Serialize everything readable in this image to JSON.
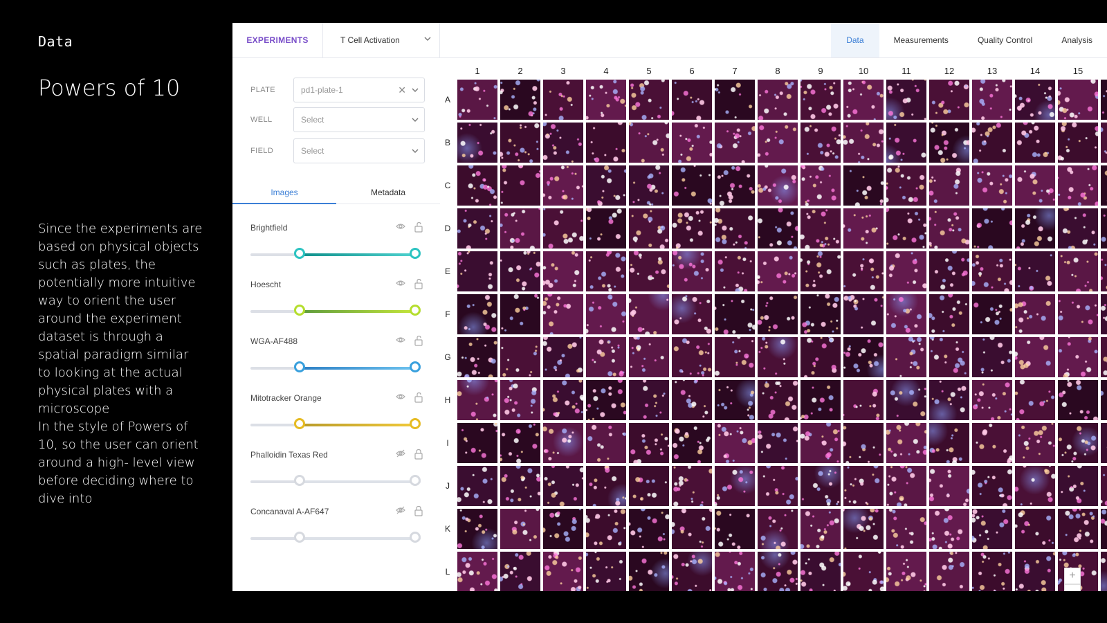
{
  "slide": {
    "eyebrow": "Data",
    "title": "Powers of 10",
    "paragraph1": "Since the experiments are based on physical objects such as plates, the potentially more intuitive way to orient the user around the experiment dataset is through a spatial paradigm similar to looking at the actual physical plates with a microscope",
    "paragraph2": "In the style of Powers of 10, so the user can orient around a high- level view before deciding where to dive into"
  },
  "topbar": {
    "experiments_tab": "EXPERIMENTS",
    "experiment_selected": "T Cell Activation",
    "nav": [
      "Data",
      "Measurements",
      "Quality Control",
      "Analysis"
    ],
    "active_nav": "Data"
  },
  "filters": {
    "plate_label": "PLATE",
    "plate_value": "pd1-plate-1",
    "well_label": "WELL",
    "well_value": "Select",
    "field_label": "FIELD",
    "field_value": "Select"
  },
  "subtabs": {
    "images": "Images",
    "metadata": "Metadata",
    "active": "Images"
  },
  "channels": [
    {
      "name": "Brightfield",
      "visible": true,
      "locked": false,
      "range": [
        0.3,
        1.0
      ],
      "color_start": "#0f8f8a",
      "color_end": "#4fd2cf",
      "knob_color": "#2cc3c1"
    },
    {
      "name": "Hoescht",
      "visible": true,
      "locked": false,
      "range": [
        0.3,
        1.0
      ],
      "color_start": "#5c9a3c",
      "color_end": "#c5e63b",
      "knob_color": "#b5de2e"
    },
    {
      "name": "WGA-AF488",
      "visible": true,
      "locked": false,
      "range": [
        0.3,
        1.0
      ],
      "color_start": "#2d7fc4",
      "color_end": "#6ec3ef",
      "knob_color": "#39a0dd"
    },
    {
      "name": "Mitotracker Orange",
      "visible": true,
      "locked": false,
      "range": [
        0.3,
        1.0
      ],
      "color_start": "#b89a2a",
      "color_end": "#f0c93a",
      "knob_color": "#e6bb22"
    },
    {
      "name": "Phalloidin Texas Red",
      "visible": false,
      "locked": true,
      "range": [
        0.3,
        1.0
      ],
      "color_start": "#dde1e8",
      "color_end": "#dde1e8",
      "knob_color": "#d6d9df"
    },
    {
      "name": "Concanaval A-AF647",
      "visible": false,
      "locked": true,
      "range": [
        0.3,
        1.0
      ],
      "color_start": "#dde1e8",
      "color_end": "#dde1e8",
      "knob_color": "#d6d9df"
    }
  ],
  "plate": {
    "columns": [
      "1",
      "2",
      "3",
      "4",
      "5",
      "6",
      "7",
      "8",
      "9",
      "10",
      "11",
      "12",
      "13",
      "14",
      "15"
    ],
    "rows": [
      "A",
      "B",
      "C",
      "D",
      "E",
      "F",
      "G",
      "H",
      "I",
      "J",
      "K",
      "L"
    ]
  },
  "zoom": {
    "plus": "+",
    "minus": "−"
  },
  "colors": {
    "accent_blue": "#3b7fd6",
    "accent_purple": "#7a4fc9",
    "well_base": "#4a1036"
  }
}
